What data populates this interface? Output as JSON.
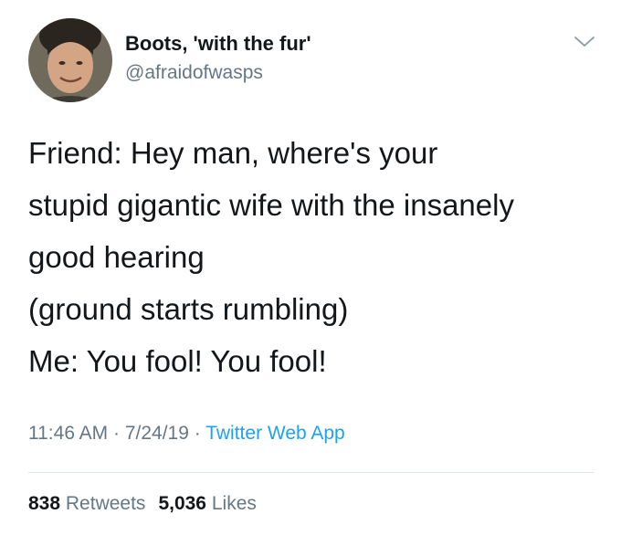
{
  "user": {
    "display_name": "Boots, 'with the fur'",
    "handle": "@afraidofwasps"
  },
  "icons": {
    "avatar": "profile-photo",
    "menu": "chevron-down-icon"
  },
  "tweet": {
    "lines": [
      "Friend: Hey man, where's your",
      "stupid gigantic wife with the insanely",
      "good hearing",
      "(ground starts rumbling)",
      "Me: You fool! You fool!"
    ]
  },
  "meta": {
    "time": "11:46 AM",
    "separator": " · ",
    "date": "7/24/19",
    "source": "Twitter Web App"
  },
  "stats": {
    "retweets_count": "838",
    "retweets_label": "Retweets",
    "likes_count": "5,036",
    "likes_label": "Likes"
  },
  "colors": {
    "text": "#14171a",
    "secondary": "#657786",
    "link": "#1da1f2",
    "divider": "#e1e8ed"
  }
}
